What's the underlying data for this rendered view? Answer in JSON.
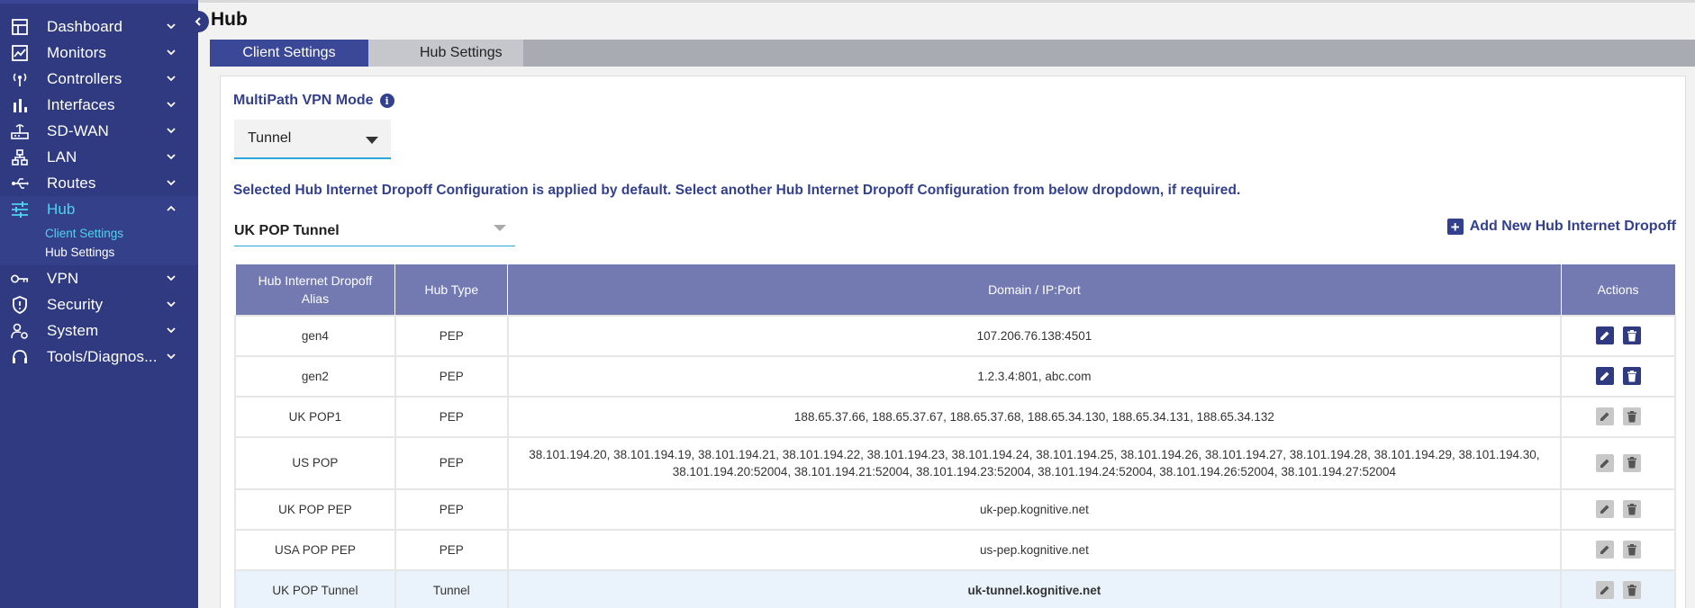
{
  "sidebar": {
    "items": [
      {
        "label": "Dashboard",
        "icon": "dashboard-icon"
      },
      {
        "label": "Monitors",
        "icon": "chart-line-icon"
      },
      {
        "label": "Controllers",
        "icon": "antenna-icon"
      },
      {
        "label": "Interfaces",
        "icon": "bar-chart-icon"
      },
      {
        "label": "SD-WAN",
        "icon": "router-icon"
      },
      {
        "label": "LAN",
        "icon": "network-icon"
      },
      {
        "label": "Routes",
        "icon": "usb-route-icon"
      },
      {
        "label": "Hub",
        "icon": "sliders-icon"
      },
      {
        "label": "VPN",
        "icon": "key-icon"
      },
      {
        "label": "Security",
        "icon": "shield-icon"
      },
      {
        "label": "System",
        "icon": "user-gear-icon"
      },
      {
        "label": "Tools/Diagnos...",
        "icon": "headset-icon"
      }
    ],
    "hub_sub": {
      "client": "Client Settings",
      "hub": "Hub Settings"
    }
  },
  "header": {
    "title": "Hub"
  },
  "tabs": {
    "client": "Client Settings",
    "hub": "Hub Settings"
  },
  "form": {
    "mode_label": "MultiPath VPN Mode",
    "mode_value": "Tunnel",
    "note": "Selected Hub Internet Dropoff Configuration is applied by default. Select another Hub Internet Dropoff Configuration from below dropdown, if required.",
    "dropoff_value": "UK POP Tunnel",
    "add_label": "Add New Hub Internet Dropoff"
  },
  "table": {
    "headers": [
      "Hub Internet Dropoff Alias",
      "Hub Type",
      "Domain / IP:Port",
      "Actions"
    ],
    "rows": [
      {
        "alias": "gen4",
        "type": "PEP",
        "domain": "107.206.76.138:4501",
        "editable": true
      },
      {
        "alias": "gen2",
        "type": "PEP",
        "domain": "1.2.3.4:801, abc.com",
        "editable": true
      },
      {
        "alias": "UK POP1",
        "type": "PEP",
        "domain": "188.65.37.66, 188.65.37.67, 188.65.37.68, 188.65.34.130, 188.65.34.131, 188.65.34.132",
        "editable": false
      },
      {
        "alias": "US POP",
        "type": "PEP",
        "domain": "38.101.194.20, 38.101.194.19, 38.101.194.21, 38.101.194.22, 38.101.194.23, 38.101.194.24, 38.101.194.25, 38.101.194.26, 38.101.194.27, 38.101.194.28, 38.101.194.29, 38.101.194.30, 38.101.194.20:52004, 38.101.194.21:52004, 38.101.194.23:52004, 38.101.194.24:52004, 38.101.194.26:52004, 38.101.194.27:52004",
        "editable": false
      },
      {
        "alias": "UK POP PEP",
        "type": "PEP",
        "domain": "uk-pep.kognitive.net",
        "editable": false
      },
      {
        "alias": "USA POP PEP",
        "type": "PEP",
        "domain": "us-pep.kognitive.net",
        "editable": false
      },
      {
        "alias": "UK POP Tunnel",
        "type": "Tunnel",
        "domain": "uk-tunnel.kognitive.net",
        "editable": false,
        "selected": true
      }
    ]
  },
  "colors": {
    "sidebar": "#2f3a80",
    "accent": "#4fd2f0",
    "header_row": "#737ab2",
    "primary": "#33408e"
  }
}
